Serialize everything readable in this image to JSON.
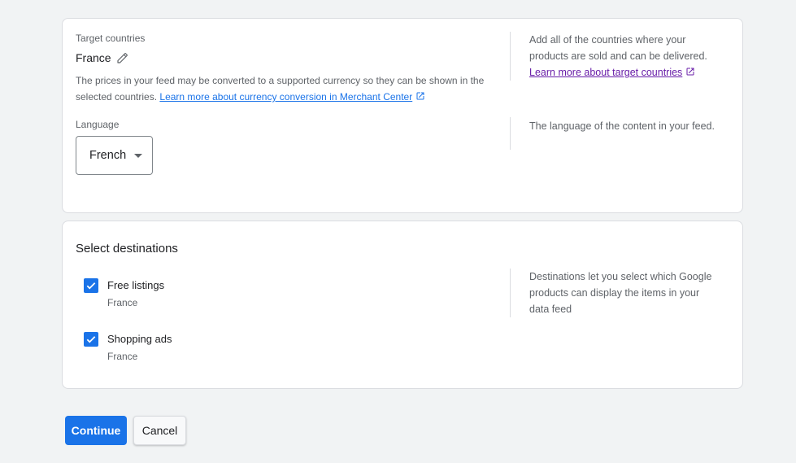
{
  "colors": {
    "accent": "#1a73e8",
    "visited_link": "#681da8",
    "page_background": "#f1f3f4"
  },
  "country_section": {
    "label": "Target countries",
    "value": "France",
    "edit_icon": "pencil-icon",
    "help_text": "The prices in your feed may be converted to a supported currency so they can be shown in the selected countries. ",
    "help_link": "Learn more about currency conversion in Merchant Center",
    "side_text": "Add all of the countries where your products are sold and can be delivered. ",
    "side_link": "Learn more about target countries"
  },
  "language_section": {
    "label": "Language",
    "selected": "French",
    "side_text": "The language of the content in your feed."
  },
  "destinations_section": {
    "title": "Select destinations",
    "side_text": "Destinations let you select which Google products can display the items in your data feed",
    "items": [
      {
        "name": "Free listings",
        "sub": "France",
        "checked": true
      },
      {
        "name": "Shopping ads",
        "sub": "France",
        "checked": true
      }
    ]
  },
  "actions": {
    "continue_label": "Continue",
    "cancel_label": "Cancel"
  }
}
